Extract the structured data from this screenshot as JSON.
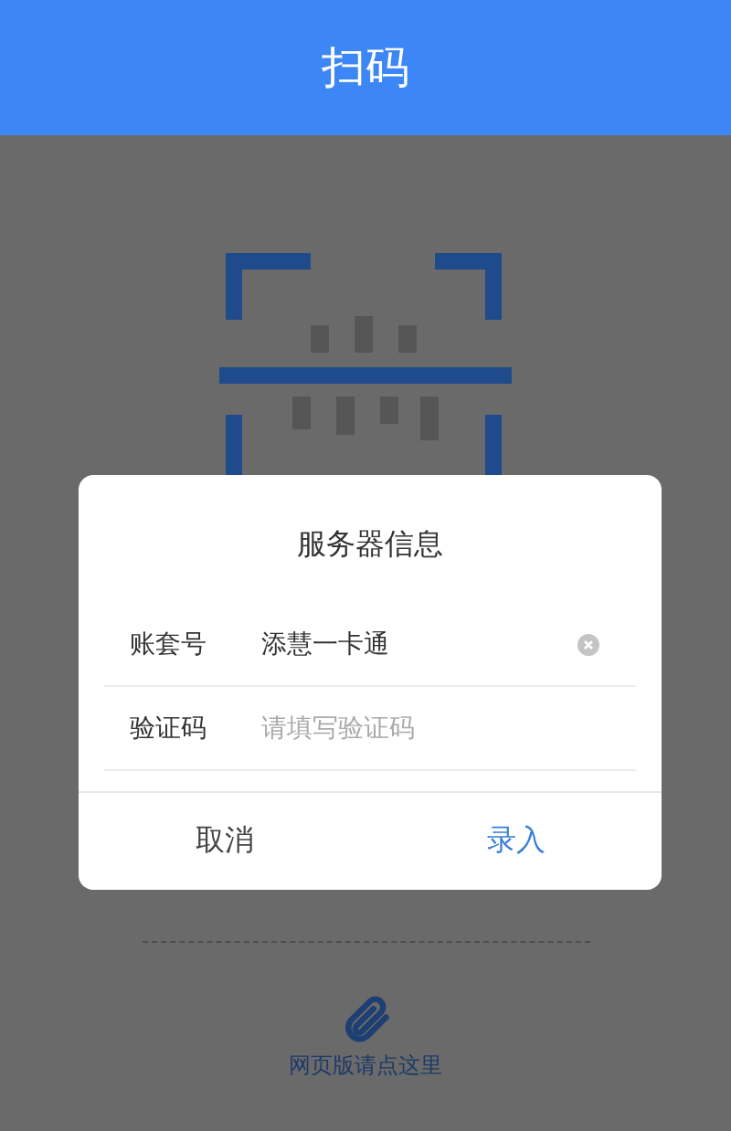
{
  "header": {
    "title": "扫码"
  },
  "web_link": {
    "label": "网页版请点这里"
  },
  "dialog": {
    "title": "服务器信息",
    "fields": [
      {
        "label": "账套号",
        "value": "添慧一卡通",
        "clearable": true
      },
      {
        "label": "验证码",
        "placeholder": "请填写验证码",
        "clearable": false
      }
    ],
    "buttons": [
      {
        "label": "取消",
        "primary": false
      },
      {
        "label": "录入",
        "primary": true
      }
    ]
  }
}
